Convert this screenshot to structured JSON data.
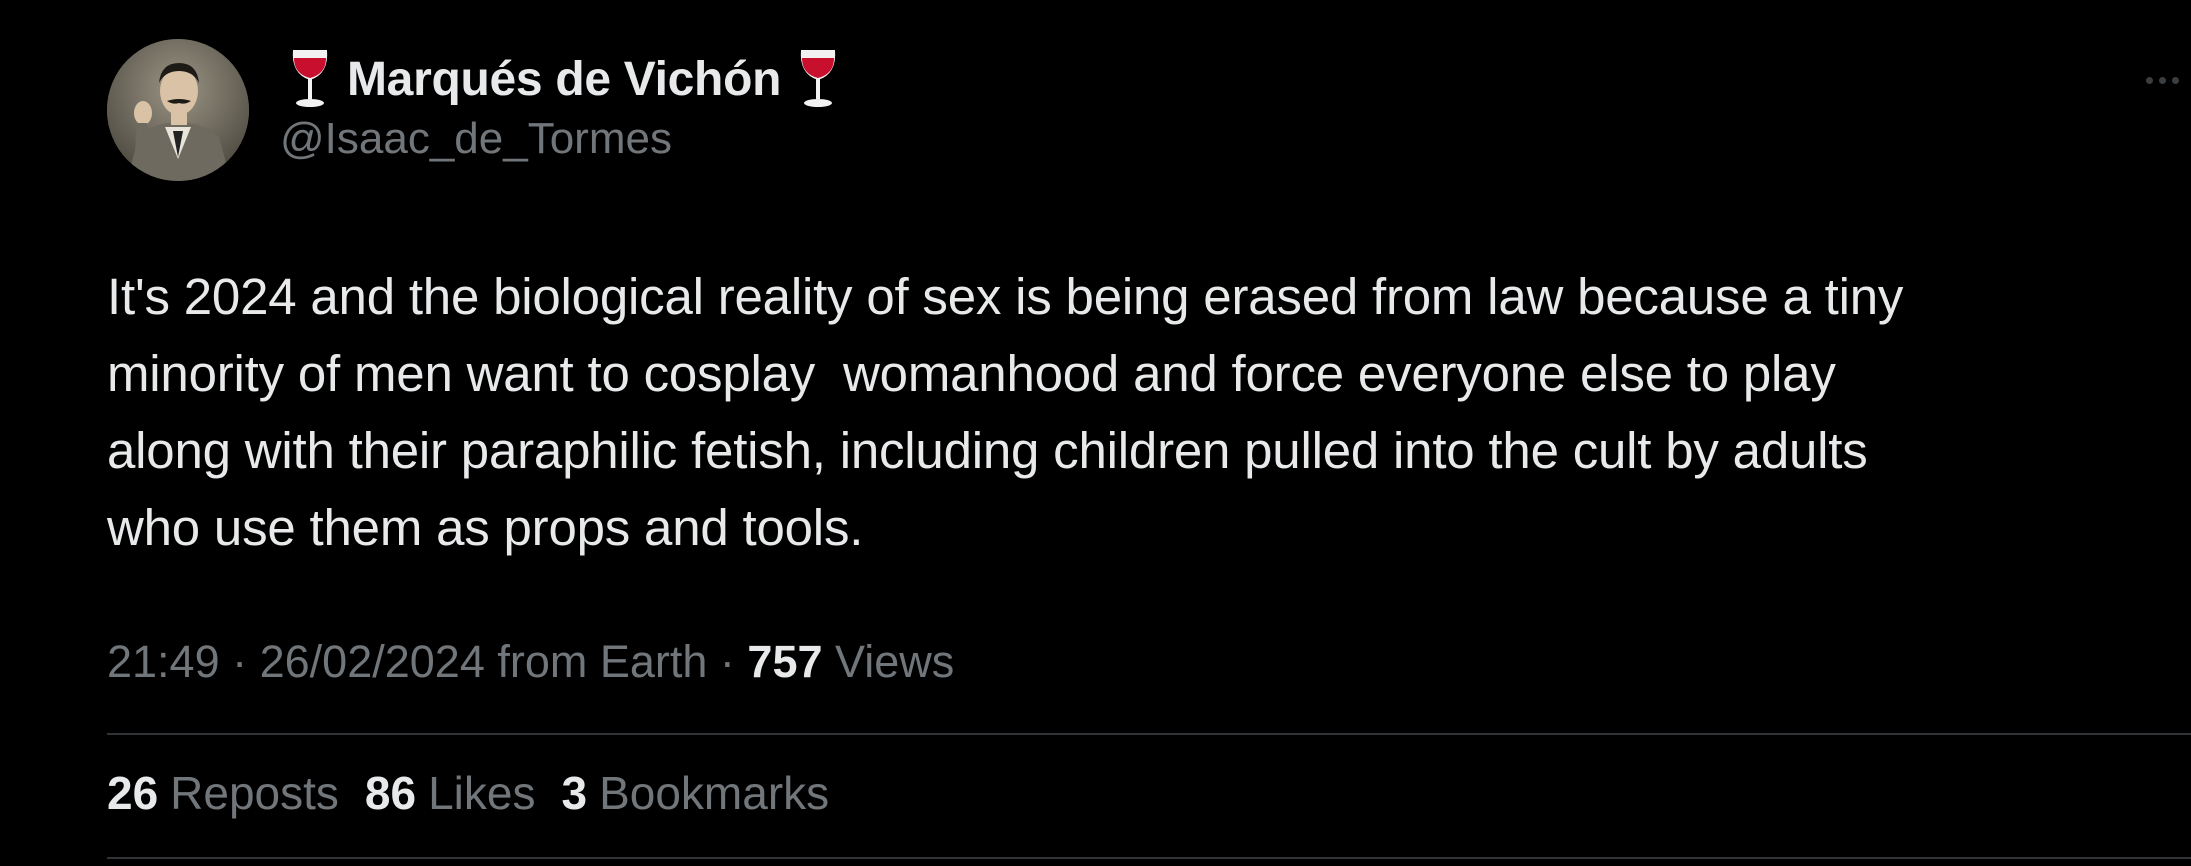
{
  "author": {
    "display_name": "Marqués de Vichón",
    "handle": "@Isaac_de_Tormes",
    "avatar_icon": "portrait-avatar",
    "name_emoji_icon": "wine-glass-icon"
  },
  "tweet": {
    "text": "It's 2024 and the biological reality of sex is being erased from law because a tiny\nminority of men want to cosplay  womanhood and force everyone else to play\nalong with their paraphilic fetish, including children pulled into the cult by adults\nwho use them as props and tools.",
    "time": "21:49",
    "sep1": " · ",
    "date": "26/02/2024",
    "source": " from Earth",
    "sep2": " · ",
    "views_count": "757",
    "views_label": " Views"
  },
  "stats": {
    "reposts_count": "26",
    "reposts_label": "Reposts",
    "likes_count": "86",
    "likes_label": "Likes",
    "bookmarks_count": "3",
    "bookmarks_label": "Bookmarks"
  },
  "colors": {
    "background": "#000000",
    "primary_text": "#e7e9ea",
    "secondary_text": "#71767b",
    "divider": "#2f3336",
    "wine": "#c8102e"
  },
  "icons": {
    "more": "more-options-icon"
  }
}
